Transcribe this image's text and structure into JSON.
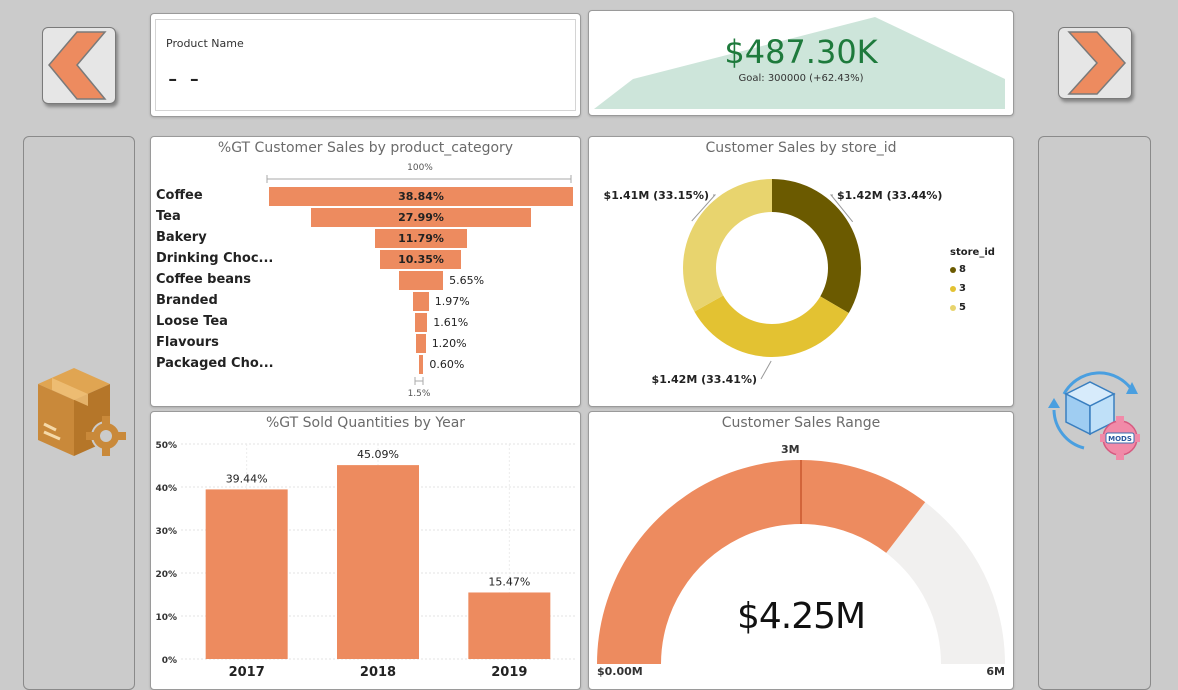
{
  "kpi_name": {
    "label": "Product Name",
    "value": "- -"
  },
  "kpi_sales": {
    "value": "$487.30K",
    "goal": "Goal: 300000 (+62.43%)"
  },
  "colors": {
    "accent": "#ed8b5f",
    "kpi_green": "#1e7a3c",
    "kpi_fill": "#cde5da",
    "donut_8": "#6b5a00",
    "donut_3": "#e3c232",
    "donut_5": "#e8d46e",
    "gauge_rest": "#f1f0ef"
  },
  "funnel": {
    "title": "%GT Customer Sales by product_category",
    "top_label": "100%",
    "bottom_label": "1.5%"
  },
  "donut": {
    "title": "Customer Sales by store_id",
    "legend_title": "store_id"
  },
  "years": {
    "title": "%GT Sold Quantities by Year"
  },
  "gauge": {
    "title": "Customer Sales Range",
    "value_label": "$4.25M",
    "min_label": "$0.00M",
    "max_label": "6M",
    "target_label": "3M"
  },
  "chart_data": [
    {
      "type": "bar",
      "orientation": "funnel",
      "title": "%GT Customer Sales by product_category",
      "categories": [
        "Coffee",
        "Tea",
        "Bakery",
        "Drinking Choc...",
        "Coffee beans",
        "Branded",
        "Loose Tea",
        "Flavours",
        "Packaged Cho..."
      ],
      "values": [
        38.84,
        27.99,
        11.79,
        10.35,
        5.65,
        1.97,
        1.61,
        1.2,
        0.6
      ],
      "labels": [
        "38.84%",
        "27.99%",
        "11.79%",
        "10.35%",
        "5.65%",
        "1.97%",
        "1.61%",
        "1.20%",
        "0.60%"
      ]
    },
    {
      "type": "pie",
      "donut": true,
      "title": "Customer Sales by store_id",
      "categories": [
        "8",
        "3",
        "5"
      ],
      "values": [
        33.44,
        33.41,
        33.15
      ],
      "labels": [
        "$1.42M (33.44%)",
        "$1.42M (33.41%)",
        "$1.41M (33.15%)"
      ],
      "legend": "right"
    },
    {
      "type": "bar",
      "title": "%GT Sold Quantities by Year",
      "categories": [
        "2017",
        "2018",
        "2019"
      ],
      "values": [
        39.44,
        45.09,
        15.47
      ],
      "labels": [
        "39.44%",
        "45.09%",
        "15.47%"
      ],
      "yticks": [
        "0%",
        "10%",
        "20%",
        "30%",
        "40%",
        "50%"
      ],
      "ylim": [
        0,
        50
      ],
      "grid": true
    },
    {
      "type": "gauge",
      "title": "Customer Sales Range",
      "value": 4.25,
      "min": 0,
      "max": 6,
      "target": 3
    }
  ]
}
